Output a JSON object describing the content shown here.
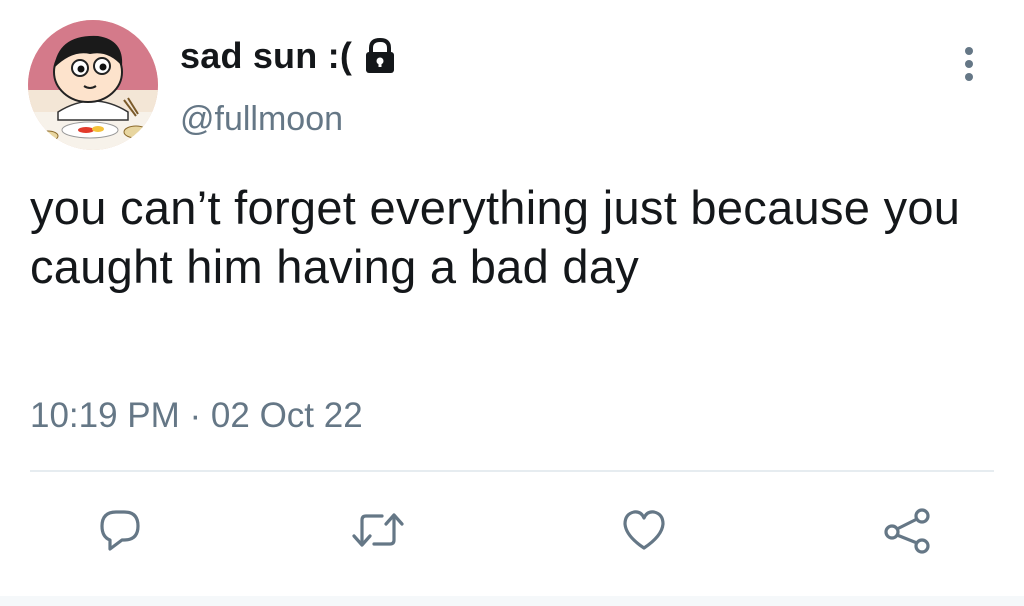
{
  "user": {
    "display_name": "sad sun :(",
    "handle": "@fullmoon",
    "avatar_icon": "cartoon-boy-avatar",
    "protected_icon": "lock-icon"
  },
  "tweet": {
    "text": "you can’t forget everything just because you caught him having a bad day",
    "timestamp": "10:19 PM · 02 Oct 22"
  },
  "actions": {
    "reply_icon": "reply-icon",
    "retweet_icon": "retweet-icon",
    "like_icon": "heart-icon",
    "share_icon": "share-icon",
    "more_icon": "more-vertical-icon"
  },
  "colors": {
    "text": "#14171a",
    "secondary": "#657786",
    "accent": "#1da1f2",
    "divider": "#e6ecf0"
  }
}
